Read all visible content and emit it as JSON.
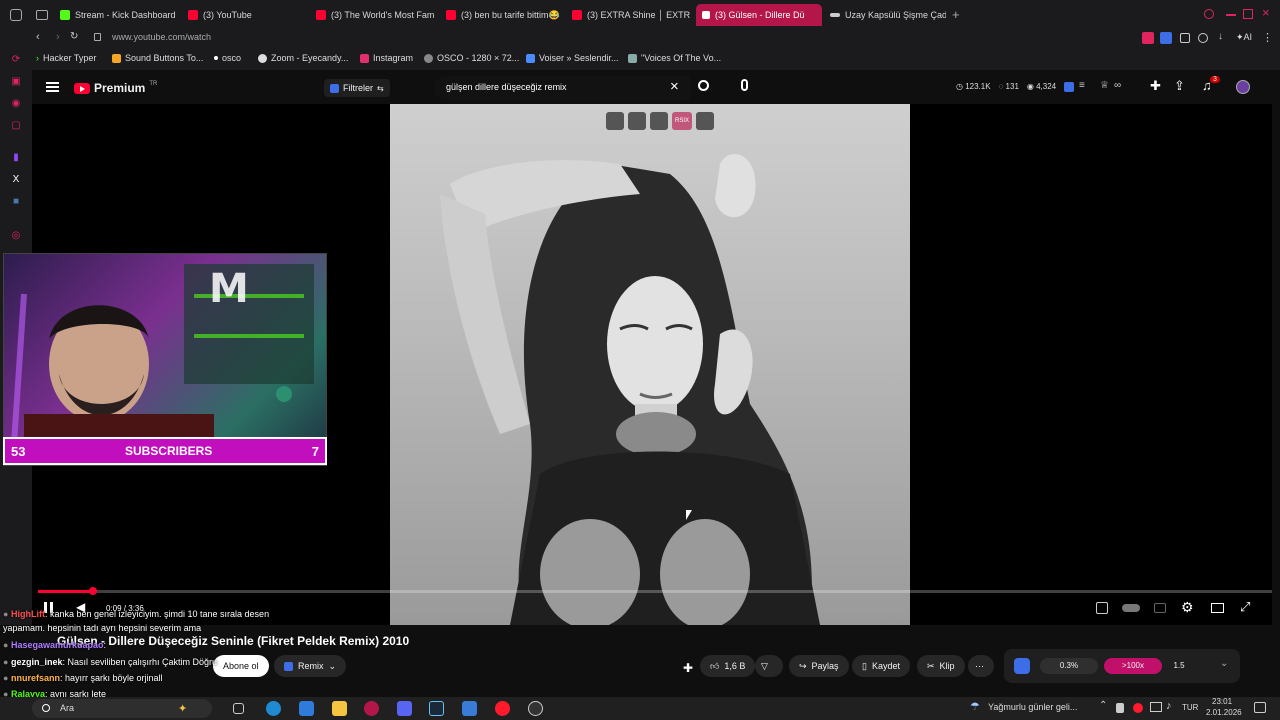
{
  "tabs": [
    {
      "label": "Stream - Kick Dashboard",
      "color": "#53fc18"
    },
    {
      "label": "(3) YouTube",
      "color": "#ff0033"
    },
    {
      "label": "(3) The World's Most Fam",
      "color": "#ff0033"
    },
    {
      "label": "(3) ben bu tarife bittim😂",
      "color": "#ff0033"
    },
    {
      "label": "(3) EXTRA Shine │ EXTR",
      "color": "#ff0033"
    },
    {
      "label": "(3) Gülsen - Dillere Dü",
      "color": "#ff0033"
    },
    {
      "label": "Uzay Kapsülü Şişme Çadır",
      "color": "#cccccc"
    }
  ],
  "address": {
    "url": "www.youtube.com/watch"
  },
  "bookmarks": [
    "Hacker Typer",
    "Sound Buttons To...",
    "osco",
    "Zoom - Eyecandy...",
    "Instagram",
    "OSCO - 1280 × 72...",
    "Voiser » Seslendir...",
    "\"Voices Of The Vo..."
  ],
  "youtube": {
    "logo": "Premium",
    "region": "TR",
    "filter_label": "Filtreler",
    "search_value": "gülşen dillere düşeceğiz remix",
    "stats": {
      "views": "123.1K",
      "likes_small": "131",
      "eye": "4,324"
    },
    "notif_count": "3"
  },
  "overlay_controls": {
    "center_badge": "RSIX"
  },
  "cam": {
    "subs_left": "53",
    "subs_label": "SUBSCRIBERS",
    "subs_right": "7"
  },
  "player": {
    "time": "0:09 / 3:36",
    "progress": 0.042
  },
  "video": {
    "title": "Gülşen - Dillere Düşeceğiz Seninle (Fikret Peldek Remix) 2010",
    "subscribe_label": "Abone ol",
    "remix_label": "Remix",
    "like_count": "1,6 B",
    "share_label": "Paylaş",
    "save_label": "Kaydet",
    "clip_label": "Klip",
    "iq_stats": {
      "a": "0.3%",
      "b": ">100x",
      "c": "1.5"
    }
  },
  "chat": [
    {
      "user": "HighLift",
      "text": ": kanka ben genel izleyiciyim. şimdi 10 tane sırala desen",
      "color": "#ff4d4d"
    },
    {
      "user": "",
      "text": "yapamam. hepsinin tadı ayrı hepsini severim ama",
      "color": "#ffffff"
    },
    {
      "user": "Hasegawamurkuapao",
      "text": ":",
      "color": "#b07cff"
    },
    {
      "user": "gezgin_inek",
      "text": ": Nasıl seviliben çalışırhı Çaktim Döğru",
      "color": "#ffffff"
    },
    {
      "user": "nnurefsann",
      "text": ": hayırr şarkı böyle orjinall",
      "color": "#ffb347"
    },
    {
      "user": "Ralayya",
      "text": ": aynı şarkı lete",
      "color": "#53fc18"
    }
  ],
  "taskbar": {
    "search_label": "Ara",
    "weather": "Yağmurlu günler geli...",
    "lang": "TUR",
    "time": "23:01",
    "date": "2.01.2026"
  }
}
